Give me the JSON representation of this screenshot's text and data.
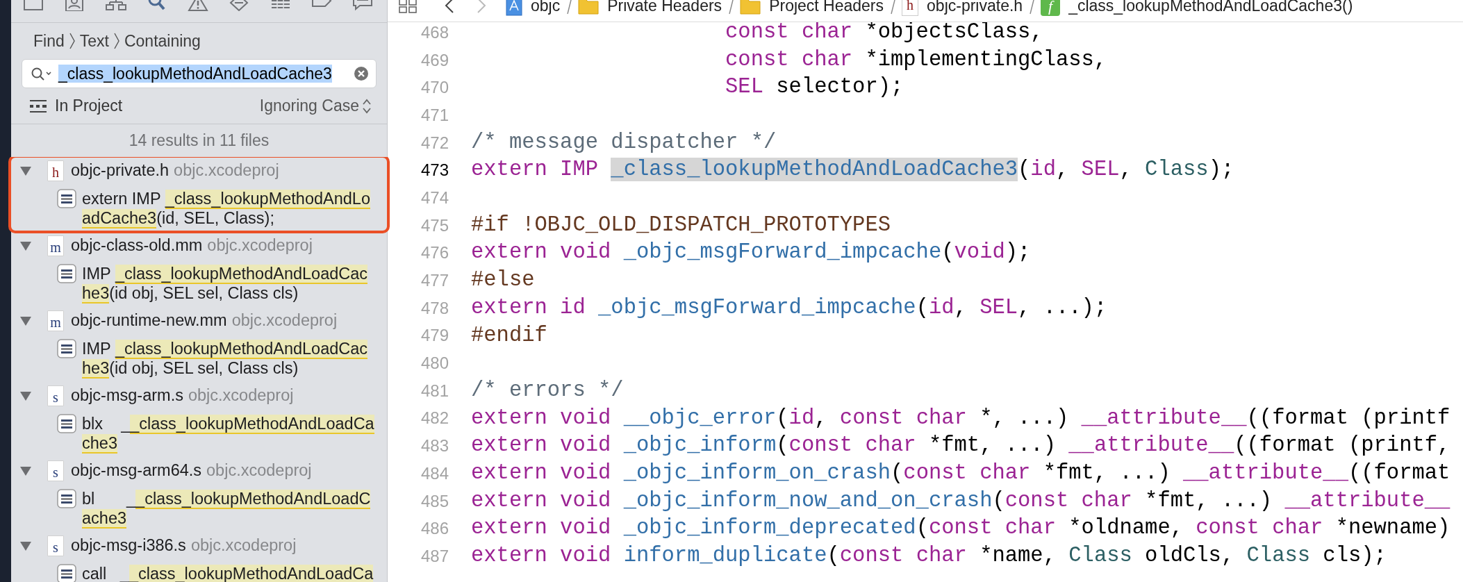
{
  "navigator_tabs": [
    {
      "kind": "window",
      "selected": false
    },
    {
      "kind": "contact",
      "selected": false
    },
    {
      "kind": "hierarchy",
      "selected": false
    },
    {
      "kind": "search",
      "selected": true
    },
    {
      "kind": "warning",
      "selected": false
    },
    {
      "kind": "diamond",
      "selected": false
    },
    {
      "kind": "list",
      "selected": false
    },
    {
      "kind": "tag",
      "selected": false
    },
    {
      "kind": "bubble",
      "selected": false
    }
  ],
  "find": {
    "path": [
      "Find",
      "Text",
      "Containing"
    ],
    "search": {
      "value": "_class_lookupMethodAndLoadCache3",
      "selected": true
    },
    "scope": "In Project",
    "matching": "Ignoring Case",
    "summary": "14 results in 11 files"
  },
  "results": [
    {
      "kind": "header",
      "icon_letter": "h",
      "file": "objc-private.h",
      "project": "objc.xcodeproj",
      "expanded": true,
      "outlined": true,
      "matches": [
        {
          "before": "extern IMP ",
          "hit": "_class_lookupMethodAndLoadCache3",
          "after": "(id, SEL, Class);"
        }
      ]
    },
    {
      "kind": "objc",
      "icon_letter": "m",
      "file": "objc-class-old.mm",
      "project": "objc.xcodeproj",
      "expanded": true,
      "outlined": false,
      "matches": [
        {
          "before": "IMP ",
          "hit": "_class_lookupMethodAndLoadCache3",
          "after": "(id obj, SEL sel, Class cls)"
        }
      ]
    },
    {
      "kind": "objc",
      "icon_letter": "m",
      "file": "objc-runtime-new.mm",
      "project": "objc.xcodeproj",
      "expanded": true,
      "outlined": false,
      "matches": [
        {
          "before": "IMP ",
          "hit": "_class_lookupMethodAndLoadCache3",
          "after": "(id obj, SEL sel, Class cls)"
        }
      ]
    },
    {
      "kind": "asm",
      "icon_letter": "s",
      "file": "objc-msg-arm.s",
      "project": "objc.xcodeproj",
      "expanded": true,
      "outlined": false,
      "matches": [
        {
          "before": "blx    _",
          "hit": "_class_lookupMethodAndLoadCache3"
        }
      ]
    },
    {
      "kind": "asm",
      "icon_letter": "s",
      "file": "objc-msg-arm64.s",
      "project": "objc.xcodeproj",
      "expanded": true,
      "outlined": false,
      "matches": [
        {
          "before": "bl       _",
          "hit": "_class_lookupMethodAndLoadCache3"
        }
      ]
    },
    {
      "kind": "asm",
      "icon_letter": "s",
      "file": "objc-msg-i386.s",
      "project": "objc.xcodeproj",
      "expanded": true,
      "outlined": false,
      "matches": [
        {
          "before": "call   _",
          "hit": "_class_lookupMethodAndLoadCa"
        }
      ]
    }
  ],
  "jump_bar": {
    "back_enabled": true,
    "forward_enabled": false,
    "items": [
      {
        "kind": "project",
        "text": "objc"
      },
      {
        "kind": "folder",
        "text": "Private Headers"
      },
      {
        "kind": "folder",
        "text": "Project Headers"
      },
      {
        "kind": "header",
        "icon_letter": "h",
        "text": "objc-private.h"
      },
      {
        "kind": "function",
        "icon_letter": "f",
        "text": "_class_lookupMethodAndLoadCache3()"
      }
    ]
  },
  "editor": {
    "lines": [
      {
        "number": "468",
        "current": false,
        "tokens": [
          {
            "kind": "keyword",
            "text": "                    const char"
          },
          {
            "kind": "plain",
            "text": " *objectsClass,"
          }
        ]
      },
      {
        "number": "469",
        "current": false,
        "tokens": [
          {
            "kind": "keyword",
            "text": "                    const char"
          },
          {
            "kind": "plain",
            "text": " *implementingClass,"
          }
        ]
      },
      {
        "number": "470",
        "current": false,
        "tokens": [
          {
            "kind": "keyword",
            "text": "                    SEL"
          },
          {
            "kind": "plain",
            "text": " selector);"
          }
        ]
      },
      {
        "number": "471",
        "current": false
      },
      {
        "number": "472",
        "current": false,
        "tokens": [
          {
            "kind": "comment",
            "text": "/* message dispatcher */"
          }
        ]
      },
      {
        "number": "473",
        "current": true,
        "tokens": [
          {
            "kind": "keyword",
            "text": "extern IMP "
          },
          {
            "kind": "search-match",
            "text": "_class_lookupMethodAndLoadCache3"
          },
          {
            "kind": "plain",
            "text": "("
          },
          {
            "kind": "keyword",
            "text": "id"
          },
          {
            "kind": "plain",
            "text": ", "
          },
          {
            "kind": "keyword",
            "text": "SEL"
          },
          {
            "kind": "plain",
            "text": ", "
          },
          {
            "kind": "type",
            "text": "Class"
          },
          {
            "kind": "plain",
            "text": ");"
          }
        ]
      },
      {
        "number": "474",
        "current": false
      },
      {
        "number": "475",
        "current": false,
        "tokens": [
          {
            "kind": "preprocessor",
            "text": "#if !OBJC_OLD_DISPATCH_PROTOTYPES"
          }
        ]
      },
      {
        "number": "476",
        "current": false,
        "tokens": [
          {
            "kind": "keyword",
            "text": "extern void"
          },
          {
            "kind": "function",
            "text": " _objc_msgForward_impcache"
          },
          {
            "kind": "plain",
            "text": "("
          },
          {
            "kind": "keyword",
            "text": "void"
          },
          {
            "kind": "plain",
            "text": ");"
          }
        ]
      },
      {
        "number": "477",
        "current": false,
        "tokens": [
          {
            "kind": "preprocessor",
            "text": "#else"
          }
        ]
      },
      {
        "number": "478",
        "current": false,
        "tokens": [
          {
            "kind": "keyword",
            "text": "extern id"
          },
          {
            "kind": "function",
            "text": " _objc_msgForward_impcache"
          },
          {
            "kind": "plain",
            "text": "("
          },
          {
            "kind": "keyword",
            "text": "id"
          },
          {
            "kind": "plain",
            "text": ", "
          },
          {
            "kind": "keyword",
            "text": "SEL"
          },
          {
            "kind": "plain",
            "text": ", ...);"
          }
        ]
      },
      {
        "number": "479",
        "current": false,
        "tokens": [
          {
            "kind": "preprocessor",
            "text": "#endif"
          }
        ]
      },
      {
        "number": "480",
        "current": false
      },
      {
        "number": "481",
        "current": false,
        "tokens": [
          {
            "kind": "comment",
            "text": "/* errors */"
          }
        ]
      },
      {
        "number": "482",
        "current": false,
        "tokens": [
          {
            "kind": "keyword",
            "text": "extern void"
          },
          {
            "kind": "function",
            "text": " __objc_error"
          },
          {
            "kind": "plain",
            "text": "("
          },
          {
            "kind": "keyword",
            "text": "id"
          },
          {
            "kind": "plain",
            "text": ", "
          },
          {
            "kind": "keyword",
            "text": "const char"
          },
          {
            "kind": "plain",
            "text": " *, ...) "
          },
          {
            "kind": "keyword",
            "text": "__attribute__"
          },
          {
            "kind": "plain",
            "text": "((format (printf"
          }
        ]
      },
      {
        "number": "483",
        "current": false,
        "tokens": [
          {
            "kind": "keyword",
            "text": "extern void"
          },
          {
            "kind": "function",
            "text": " _objc_inform"
          },
          {
            "kind": "plain",
            "text": "("
          },
          {
            "kind": "keyword",
            "text": "const char"
          },
          {
            "kind": "plain",
            "text": " *fmt, ...) "
          },
          {
            "kind": "keyword",
            "text": "__attribute__"
          },
          {
            "kind": "plain",
            "text": "((format (printf,"
          }
        ]
      },
      {
        "number": "484",
        "current": false,
        "tokens": [
          {
            "kind": "keyword",
            "text": "extern void"
          },
          {
            "kind": "function",
            "text": " _objc_inform_on_crash"
          },
          {
            "kind": "plain",
            "text": "("
          },
          {
            "kind": "keyword",
            "text": "const char"
          },
          {
            "kind": "plain",
            "text": " *fmt, ...) "
          },
          {
            "kind": "keyword",
            "text": "__attribute__"
          },
          {
            "kind": "plain",
            "text": "((format"
          }
        ]
      },
      {
        "number": "485",
        "current": false,
        "tokens": [
          {
            "kind": "keyword",
            "text": "extern void"
          },
          {
            "kind": "function",
            "text": " _objc_inform_now_and_on_crash"
          },
          {
            "kind": "plain",
            "text": "("
          },
          {
            "kind": "keyword",
            "text": "const char"
          },
          {
            "kind": "plain",
            "text": " *fmt, ...) "
          },
          {
            "kind": "keyword",
            "text": "__attribute__"
          }
        ]
      },
      {
        "number": "486",
        "current": false,
        "tokens": [
          {
            "kind": "keyword",
            "text": "extern void"
          },
          {
            "kind": "function",
            "text": " _objc_inform_deprecated"
          },
          {
            "kind": "plain",
            "text": "("
          },
          {
            "kind": "keyword",
            "text": "const char"
          },
          {
            "kind": "plain",
            "text": " *oldname, "
          },
          {
            "kind": "keyword",
            "text": "const char"
          },
          {
            "kind": "plain",
            "text": " *newname)"
          }
        ]
      },
      {
        "number": "487",
        "current": false,
        "tokens": [
          {
            "kind": "keyword",
            "text": "extern void"
          },
          {
            "kind": "function",
            "text": " inform_duplicate"
          },
          {
            "kind": "plain",
            "text": "("
          },
          {
            "kind": "keyword",
            "text": "const char"
          },
          {
            "kind": "plain",
            "text": " *name, "
          },
          {
            "kind": "type",
            "text": "Class"
          },
          {
            "kind": "plain",
            "text": " oldCls, "
          },
          {
            "kind": "type",
            "text": "Class"
          },
          {
            "kind": "plain",
            "text": " cls);"
          }
        ]
      }
    ]
  }
}
